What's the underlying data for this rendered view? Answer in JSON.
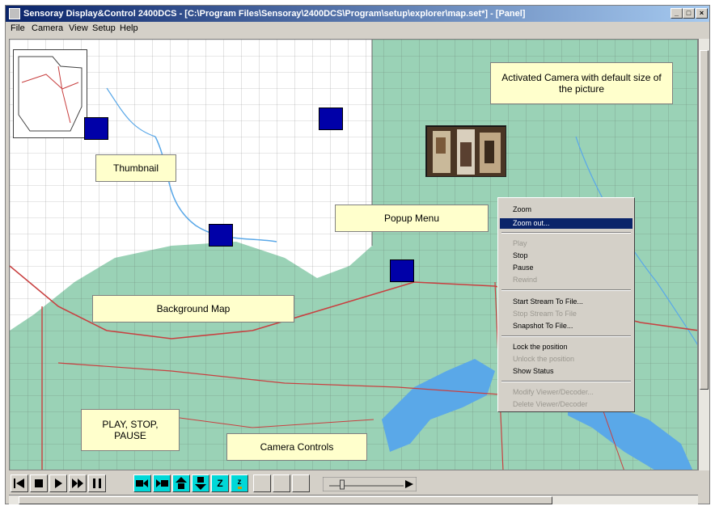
{
  "window": {
    "title": "Sensoray Display&Control 2400DCS - [C:\\Program Files\\Sensoray\\2400DCS\\Program\\setup\\explorer\\map.set*] - [Panel]",
    "minimize_glyph": "_",
    "restore_glyph": "□",
    "close_glyph": "×"
  },
  "menubar": {
    "items": [
      "File",
      "Camera",
      "View",
      "Setup",
      "Help"
    ]
  },
  "callouts": {
    "thumbnail": "Thumbnail",
    "activated_camera": "Activated Camera with default size of the picture",
    "popup_menu": "Popup Menu",
    "background_map": "Background Map",
    "play_stop_pause": "PLAY, STOP, PAUSE",
    "camera_controls": "Camera Controls"
  },
  "popup_menu": {
    "items": [
      {
        "label": "Zoom",
        "enabled": true,
        "selected": false
      },
      {
        "label": "Zoom out...",
        "enabled": true,
        "selected": true
      },
      {
        "label": "Play",
        "enabled": false,
        "selected": false
      },
      {
        "label": "Stop",
        "enabled": true,
        "selected": false
      },
      {
        "label": "Pause",
        "enabled": true,
        "selected": false
      },
      {
        "label": "Rewind",
        "enabled": false,
        "selected": false
      },
      {
        "label": "Start Stream To File...",
        "enabled": true,
        "selected": false
      },
      {
        "label": "Stop Stream To File",
        "enabled": false,
        "selected": false
      },
      {
        "label": "Snapshot To File...",
        "enabled": true,
        "selected": false
      },
      {
        "label": "Lock the position",
        "enabled": true,
        "selected": false
      },
      {
        "label": "Unlock the position",
        "enabled": false,
        "selected": false
      },
      {
        "label": "Show Status",
        "enabled": true,
        "selected": false
      },
      {
        "label": "Modify Viewer/Decoder...",
        "enabled": false,
        "selected": false
      },
      {
        "label": "Delete Viewer/Decoder",
        "enabled": false,
        "selected": false
      }
    ]
  },
  "toolbar": {
    "playback": [
      {
        "name": "rewind-to-start-icon"
      },
      {
        "name": "stop-icon"
      },
      {
        "name": "play-icon"
      },
      {
        "name": "fast-forward-icon"
      },
      {
        "name": "pause-icon"
      }
    ],
    "camera_controls": [
      {
        "name": "pan-left-icon"
      },
      {
        "name": "pan-right-icon"
      },
      {
        "name": "tilt-up-icon"
      },
      {
        "name": "tilt-down-icon"
      },
      {
        "name": "zoom-in-icon",
        "label": "Z"
      },
      {
        "name": "zoom-out-icon",
        "label": "z"
      }
    ],
    "volume_level": 0.15
  },
  "colors": {
    "map_green": "#9ad2b6",
    "water_blue": "#5aa8e8",
    "callout_fill": "#ffffcc",
    "thumbnail_blue": "#0000a8",
    "camera_button_cyan": "#00d8d8",
    "menu_highlight": "#0a246a",
    "road_red": "#c84040"
  }
}
